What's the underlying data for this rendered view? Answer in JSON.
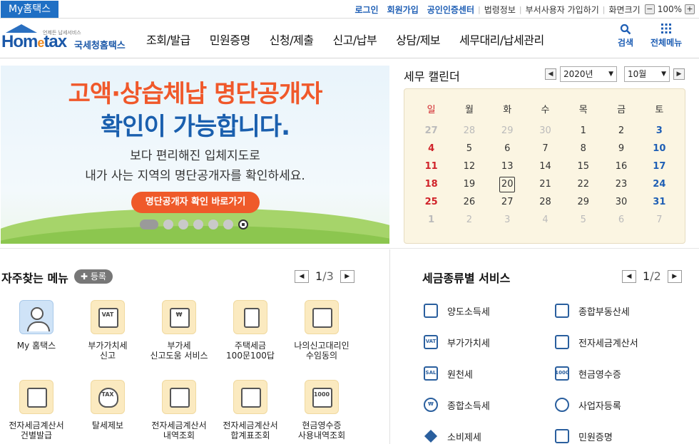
{
  "topbar": {
    "my_tab": "My홈택스",
    "login": "로그인",
    "signup": "회원가입",
    "cert_center": "공인인증센터",
    "law": "법령정보",
    "dept_join": "부서사용자 가입하기",
    "screen_size": "화면크기",
    "zoom_minus": "−",
    "zoom_value": "100%",
    "zoom_plus": "+"
  },
  "header": {
    "logo_small": "언제든 납세서비스",
    "logo_brand_a": "Hom",
    "logo_brand_e": "e",
    "logo_brand_b": "tax",
    "logo_name": "국세청홈택스",
    "nav": [
      "조회/발급",
      "민원증명",
      "신청/제출",
      "신고/납부",
      "상담/제보",
      "세무대리/납세관리"
    ],
    "search_icon": "search-icon",
    "search_label": "검색",
    "menu_icon": "grid-icon",
    "menu_label": "전체메뉴"
  },
  "banner": {
    "line1": "고액·상습체납 명단공개자",
    "line2": "확인이 가능합니다.",
    "line3": "보다 편리해진 입체지도로",
    "line4": "내가 사는 지역의 명단공개자를 확인하세요.",
    "cta": "명단공개자 확인 바로가기",
    "slide_count": 6,
    "active_slide": 1
  },
  "calendar": {
    "title": "세무 캘린더",
    "prev": "◀",
    "next": "▶",
    "year": "2020년",
    "month": "10월",
    "weekdays": [
      "일",
      "월",
      "화",
      "수",
      "목",
      "금",
      "토"
    ],
    "weeks": [
      [
        "27",
        "28",
        "29",
        "30",
        "1",
        "2",
        "3"
      ],
      [
        "4",
        "5",
        "6",
        "7",
        "8",
        "9",
        "10"
      ],
      [
        "11",
        "12",
        "13",
        "14",
        "15",
        "16",
        "17"
      ],
      [
        "18",
        "19",
        "20",
        "21",
        "22",
        "23",
        "24"
      ],
      [
        "25",
        "26",
        "27",
        "28",
        "29",
        "30",
        "31"
      ],
      [
        "1",
        "2",
        "3",
        "4",
        "5",
        "6",
        "7"
      ]
    ],
    "today": "20"
  },
  "frequent": {
    "title": "자주찾는 메뉴",
    "register": "등록",
    "page_current": "1",
    "page_total": "/3",
    "items": [
      {
        "icon": "person-icon",
        "label1": "My 홈택스",
        "label2": ""
      },
      {
        "icon": "vat-doc-icon",
        "label1": "부가가치세",
        "label2": "신고"
      },
      {
        "icon": "won-search-icon",
        "label1": "부가세",
        "label2": "신고도움 서비스"
      },
      {
        "icon": "building-icon",
        "label1": "주택세금",
        "label2": "100문100답"
      },
      {
        "icon": "doc-pen-icon",
        "label1": "나의신고대리인",
        "label2": "수임동의"
      },
      {
        "icon": "invoice-icon",
        "label1": "전자세금계산서",
        "label2": "건별발급"
      },
      {
        "icon": "tax-bag-icon",
        "label1": "탈세제보",
        "label2": ""
      },
      {
        "icon": "invoice-search-icon",
        "label1": "전자세금계산서",
        "label2": "내역조회"
      },
      {
        "icon": "invoice-plus-icon",
        "label1": "전자세금계산서",
        "label2": "합계표조회"
      },
      {
        "icon": "receipt-search-icon",
        "label1": "현금영수증",
        "label2": "사용내역조회"
      }
    ],
    "icon_texts": [
      "",
      "VAT",
      "₩",
      "",
      "",
      "",
      "TAX",
      "",
      "",
      "1000"
    ]
  },
  "tax_services": {
    "title": "세금종류별 서비스",
    "page_current": "1",
    "page_total": "/2",
    "items": [
      {
        "icon": "transfer-doc-icon",
        "label": "양도소득세",
        "tag": ""
      },
      {
        "icon": "real-estate-icon",
        "label": "종합부동산세",
        "tag": ""
      },
      {
        "icon": "vat-icon",
        "label": "부가가치세",
        "tag": "VAT"
      },
      {
        "icon": "invoice-icon",
        "label": "전자세금계산서",
        "tag": ""
      },
      {
        "icon": "withholding-icon",
        "label": "원천세",
        "tag": "SAL"
      },
      {
        "icon": "cash-receipt-icon",
        "label": "현금영수증",
        "tag": "1000"
      },
      {
        "icon": "income-icon",
        "label": "종합소득세",
        "tag": "₩"
      },
      {
        "icon": "business-reg-icon",
        "label": "사업자등록",
        "tag": ""
      },
      {
        "icon": "diamond-icon",
        "label": "소비제세",
        "tag": ""
      },
      {
        "icon": "certificate-icon",
        "label": "민원증명",
        "tag": ""
      }
    ]
  }
}
